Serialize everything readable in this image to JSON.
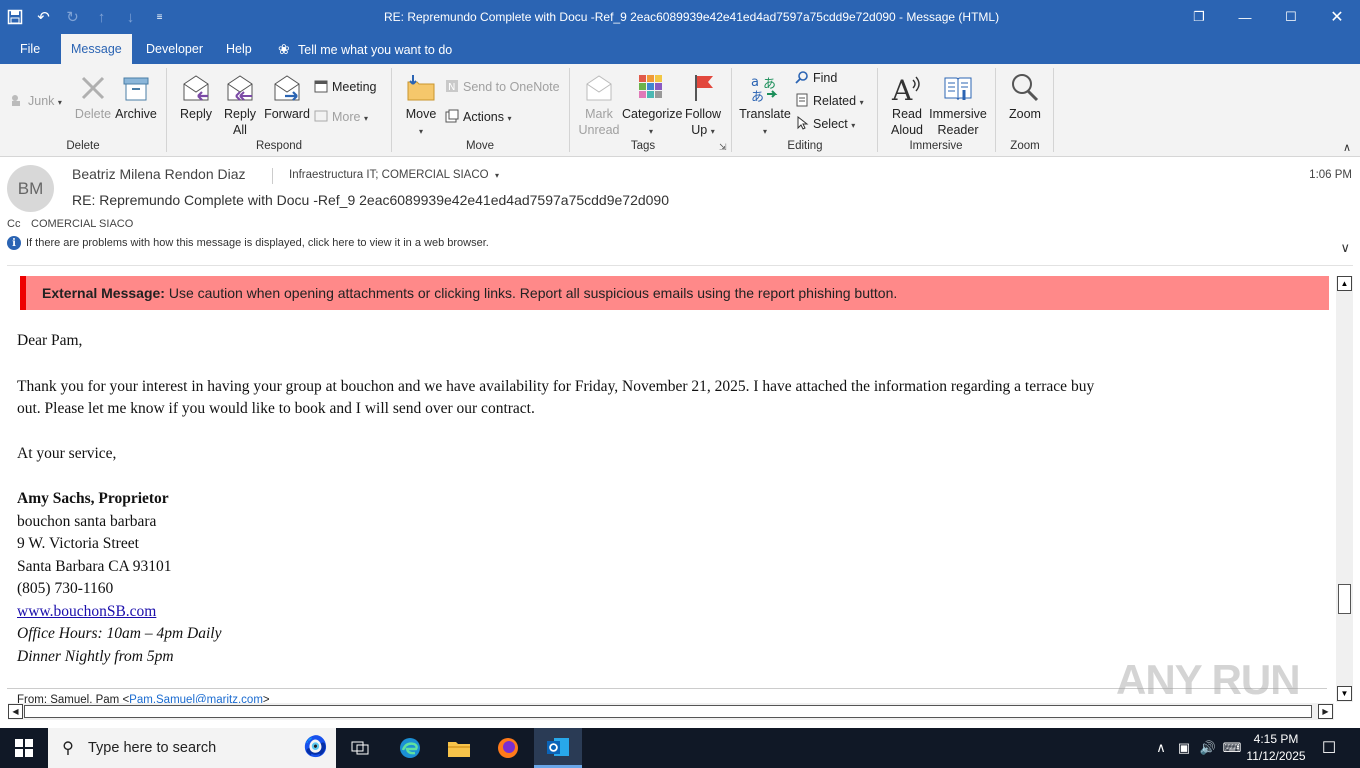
{
  "window": {
    "title": "RE: Repremundo Complete with Docu -Ref_9 2eac6089939e42e41ed4ad7597a75cdd9e72d090  -  Message (HTML)",
    "qat_icons": [
      "save-icon",
      "undo-icon",
      "redo-icon",
      "up-icon",
      "down-icon",
      "customize-icon"
    ],
    "controls": [
      "restore-ribbon-icon",
      "minimize-icon",
      "maximize-icon",
      "close-icon"
    ]
  },
  "tabs": [
    {
      "label": "File"
    },
    {
      "label": "Message"
    },
    {
      "label": "Developer"
    },
    {
      "label": "Help"
    }
  ],
  "tellme": "Tell me what you want to do",
  "ribbon": {
    "junk": "Junk",
    "delete": "Delete",
    "archive": "Archive",
    "group_delete": "Delete",
    "reply": "Reply",
    "reply_all_1": "Reply",
    "reply_all_2": "All",
    "forward": "Forward",
    "meeting": "Meeting",
    "more": "More",
    "group_respond": "Respond",
    "move": "Move",
    "send_onenote": "Send to OneNote",
    "actions": "Actions",
    "group_move": "Move",
    "mark_unread_1": "Mark",
    "mark_unread_2": "Unread",
    "categorize": "Categorize",
    "follow_up_1": "Follow",
    "follow_up_2": "Up",
    "group_tags": "Tags",
    "translate": "Translate",
    "find": "Find",
    "related": "Related",
    "select": "Select",
    "group_editing": "Editing",
    "read_aloud_1": "Read",
    "read_aloud_2": "Aloud",
    "immersive_1": "Immersive",
    "immersive_2": "Reader",
    "group_immersive": "Immersive",
    "zoom": "Zoom",
    "group_zoom": "Zoom"
  },
  "message": {
    "avatar_initials": "BM",
    "sender": "Beatriz Milena Rendon Diaz",
    "recipients": "Infraestructura IT; COMERCIAL SIACO",
    "time": "1:06 PM",
    "subject": "RE: Repremundo Complete with Docu -Ref_9 2eac6089939e42e41ed4ad7597a75cdd9e72d090",
    "cc_label": "Cc",
    "cc_value": "COMERCIAL SIACO",
    "info_bar": "If there are problems with how this message is displayed, click here to view it in a web browser."
  },
  "body": {
    "banner_bold": "External Message:",
    "banner_text": " Use caution when opening attachments or clicking links. Report all suspicious emails using the report phishing button.",
    "greeting": "Dear Pam,",
    "para1_line1": "Thank you for your interest in having your group at bouchon and we have availability for Friday, November 21, 2025.  I have attached the information regarding a terrace buy",
    "para1_line2": "out.  Please let me know if you would like to book and I will send over our contract.",
    "closing": "At your service,",
    "sig_name": "Amy Sachs, Proprietor",
    "sig_company": "bouchon santa barbara",
    "sig_street": "9 W. Victoria Street",
    "sig_city": "Santa Barbara  CA 93101",
    "sig_phone": "(805) 730-1160",
    "sig_web": "www.bouchonSB.com",
    "sig_hours": "Office Hours: 10am – 4pm Daily",
    "sig_dinner": "Dinner Nightly from 5pm",
    "from_label": "From: Samuel, Pam <",
    "from_email": "Pam.Samuel@maritz.com",
    "from_end": ">"
  },
  "watermark": "ANY RUN",
  "taskbar": {
    "search_placeholder": "Type here to search",
    "time": "4:15 PM",
    "date": "11/12/2025",
    "apps": [
      "task-view-icon",
      "edge-icon",
      "file-explorer-icon",
      "firefox-icon",
      "outlook-icon"
    ]
  },
  "colors": {
    "accent": "#2b64b3",
    "banner_bg": "#ff8989",
    "banner_border": "#ee0000",
    "taskbar": "#101826"
  }
}
